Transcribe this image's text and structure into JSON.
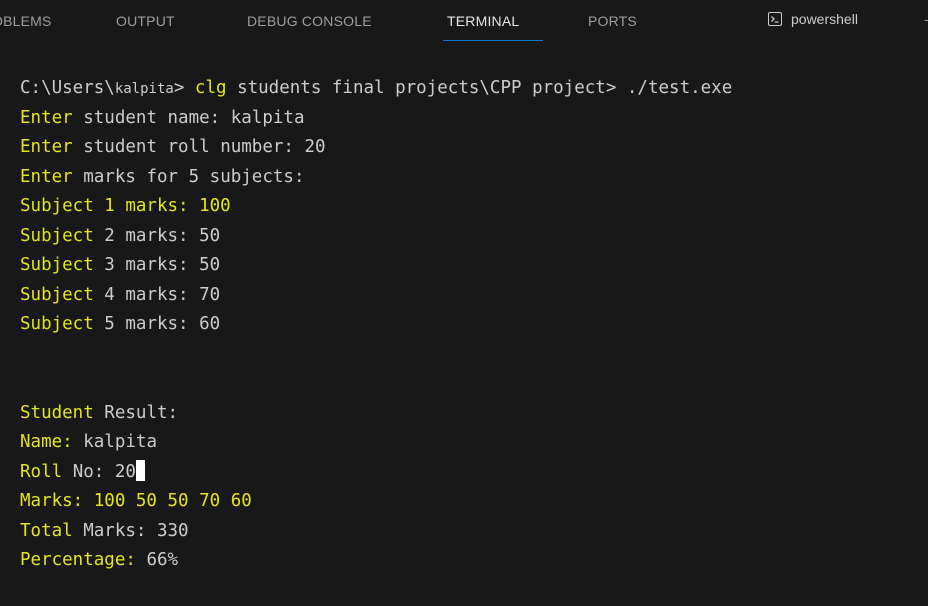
{
  "tabs": [
    {
      "label": "OBLEMS"
    },
    {
      "label": "OUTPUT"
    },
    {
      "label": "DEBUG CONSOLE"
    },
    {
      "label": "TERMINAL"
    },
    {
      "label": "PORTS"
    }
  ],
  "active_tab": "TERMINAL",
  "shell": {
    "label": "powershell",
    "icon": "terminal-icon"
  },
  "terminal": {
    "prompt": {
      "path_start": "C:\\Users\\",
      "user": "kalpita",
      "path_mid": "> ",
      "cmd": "clg",
      "path_rest": " students final projects\\CPP project> ./test.exe"
    },
    "input_lines": [
      {
        "key": "Enter",
        "rest": " student name: kalpita"
      },
      {
        "key": "Enter",
        "rest": " student roll number: 20"
      },
      {
        "key": "Enter",
        "rest": " marks for 5 subjects:"
      },
      {
        "key": "Subject 1 marks: 100",
        "rest": ""
      },
      {
        "key": "Subject",
        "rest": " 2 marks: 50"
      },
      {
        "key": "Subject",
        "rest": " 3 marks: 50"
      },
      {
        "key": "Subject",
        "rest": " 4 marks: 70"
      },
      {
        "key": "Subject",
        "rest": " 5 marks: 60"
      }
    ],
    "result_lines": [
      {
        "key": "Student",
        "rest": " Result:"
      },
      {
        "key": "Name:",
        "rest": " kalpita"
      },
      {
        "key": "Roll",
        "rest": " No: 20"
      },
      {
        "key": "Marks: 100 50 50 70 60",
        "rest": ""
      },
      {
        "key": "Total",
        "rest": " Marks: 330"
      },
      {
        "key": "Percentage:",
        "rest": " 66%"
      }
    ]
  },
  "colors": {
    "background": "#181818",
    "text": "#cccccc",
    "highlight": "#e5e510",
    "accent": "#0078d4"
  }
}
